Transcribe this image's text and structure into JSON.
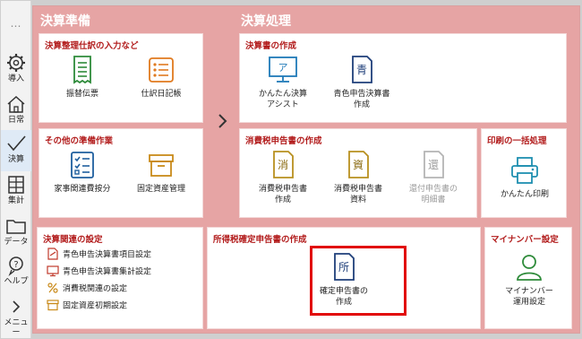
{
  "sidebar": {
    "dots": "…",
    "items": [
      {
        "label": "導入",
        "icon": "gear-icon"
      },
      {
        "label": "日常",
        "icon": "home-icon"
      },
      {
        "label": "決算",
        "icon": "check-icon"
      },
      {
        "label": "集計",
        "icon": "table-icon"
      },
      {
        "label": "データ",
        "icon": "folder-icon"
      },
      {
        "label": "ヘルプ",
        "icon": "help-icon"
      },
      {
        "label": "メニュー",
        "icon": "chevron-right-icon"
      }
    ],
    "active_index": 2
  },
  "kessan_junbi": {
    "title": "決算準備",
    "shiwake": {
      "title": "決算整理仕訳の入力など",
      "tiles": [
        {
          "label": "振替伝票",
          "icon": "receipt-icon"
        },
        {
          "label": "仕訳日記帳",
          "icon": "list-icon"
        }
      ]
    },
    "sonota": {
      "title": "その他の準備作業",
      "tiles": [
        {
          "label": "家事関連費按分",
          "icon": "checklist-icon"
        },
        {
          "label": "固定資産管理",
          "icon": "box-icon"
        }
      ]
    }
  },
  "kessan_shori": {
    "title": "決算処理",
    "sakusei": {
      "title": "決算書の作成",
      "tiles": [
        {
          "label": "かんたん決算\nアシスト",
          "icon": "monitor-icon",
          "glyph": "ア"
        },
        {
          "label": "青色申告決算書\n作成",
          "icon": "document-icon",
          "glyph": "青"
        }
      ]
    },
    "shohizei": {
      "title": "消費税申告書の作成",
      "tiles": [
        {
          "label": "消費税申告書\n作成",
          "icon": "document-icon",
          "glyph": "消"
        },
        {
          "label": "消費税申告書\n資料",
          "icon": "document-icon",
          "glyph": "資"
        },
        {
          "label": "還付申告書の\n明細書",
          "icon": "document-icon",
          "glyph": "還"
        }
      ]
    },
    "insatsu": {
      "title": "印刷の一括処理",
      "tiles": [
        {
          "label": "かんたん印刷",
          "icon": "printer-icon"
        }
      ]
    }
  },
  "kanren": {
    "title": "決算関連の設定",
    "links": [
      {
        "label": "青色申告決算書項目設定",
        "icon": "doc-edit-icon"
      },
      {
        "label": "青色申告決算書集計設定",
        "icon": "monitor-settings-icon"
      },
      {
        "label": "消費税関連の設定",
        "icon": "percent-icon"
      },
      {
        "label": "固定資産初期設定",
        "icon": "box-small-icon"
      }
    ]
  },
  "shotoku": {
    "title": "所得税確定申告書の作成",
    "tile": {
      "label": "確定申告書の\n作成",
      "icon": "document-icon",
      "glyph": "所"
    }
  },
  "mynumber": {
    "title": "マイナンバー設定",
    "tile": {
      "label": "マイナンバー\n運用設定",
      "icon": "person-icon"
    }
  },
  "colors": {
    "accent_red": "#b21c1c",
    "area_bg": "#e6a4a4",
    "icon_blue": "#1f5f9e",
    "icon_green": "#2e8b3a",
    "icon_orange": "#e07a1f",
    "highlight": "#e10a0a"
  }
}
